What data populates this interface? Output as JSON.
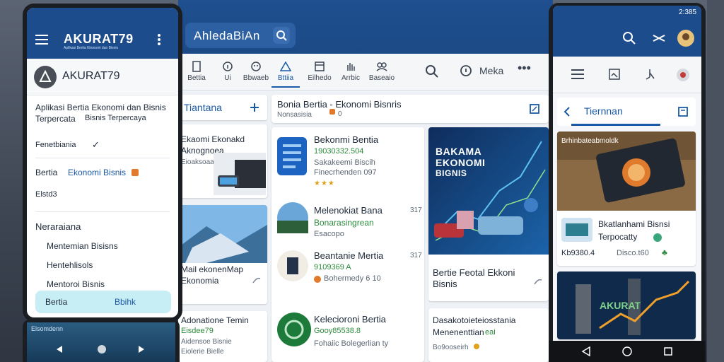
{
  "left_phone": {
    "status_time": "",
    "brand": "AKURAT79",
    "brand_tagline": "Aplikasi Berita Ekonomi dan Bisnis",
    "drawer_brand": "AKURAT79",
    "description_line1": "Aplikasi Bertia Ekonomi dan Bisnis",
    "description_line2": "Terpercata",
    "description_line2b": "Bisnis Terpercaya",
    "verified_label": "Fenetbiania",
    "menu_item_1": "Bertia",
    "menu_item_1b": "Ekonomi Bisnis",
    "menu_item_2": "Elstd3",
    "section_title": "Neraraiana",
    "sub_1": "Mentemian Bisisns",
    "sub_2": "Hentehlisols",
    "sub_3": "Mentoroi Bisnis",
    "active_left": "Bertia",
    "active_right": "Bbihk",
    "bottom_label": "Elsomdenn"
  },
  "tablet": {
    "search_text": "AhledaBiAn",
    "toolbar": [
      {
        "label": "Bettia",
        "icon": "bookmark-icon"
      },
      {
        "label": "Ui",
        "icon": "info-icon"
      },
      {
        "label": "Bbwaeb",
        "icon": "face-icon"
      },
      {
        "label": "Bttiia",
        "icon": "warning-icon"
      },
      {
        "label": "Eilhedo",
        "icon": "calendar-icon"
      },
      {
        "label": "Arrbic",
        "icon": "hand-icon"
      },
      {
        "label": "Baseaio",
        "icon": "people-icon"
      }
    ],
    "toolbar_right_label": "Meka",
    "left_column": {
      "title": "Tiantana",
      "items": [
        {
          "title": "Ekaomi Ekonakd",
          "subtitle": "Aknognoea",
          "meta": "Eioaksoaa"
        },
        {
          "title": "Mail ekonenMap",
          "subtitle": "Ekonomia"
        },
        {
          "title": "Adonatione Temin",
          "subtitle": "Eisdee79",
          "meta": "Aidensoe Bisnie",
          "meta2": "Eiolerie Bielle"
        }
      ]
    },
    "feed_header": {
      "title": "Bonia Bertia - Ekonomi Bisnris",
      "subtitle": "Nonsasisia",
      "count": "0"
    },
    "feed": [
      {
        "title": "Bekonmi Bentia",
        "line1": "19030332.504",
        "line2": "Sakakeemi Biscih",
        "line3": "Finecrhenden 097"
      },
      {
        "title": "Melenokiat Bana",
        "line1": "Bonarasingrean",
        "line2": "Esacopo",
        "meta": "317"
      },
      {
        "title": "Beantanie Mertia",
        "line1": "9109369 A",
        "line2": "Bohermedy 6 10",
        "meta": "317"
      },
      {
        "title": "Kelecioroni Bertia",
        "line1": "Gooy85538.8",
        "line2": "Fohaiic Bolegerlian ty"
      }
    ],
    "feature_top": {
      "image_text_1": "BAKAMA",
      "image_text_2": "EKONOMI",
      "image_text_3": "BIGNIS",
      "caption_line1": "Bertie Feotal Ekkoni",
      "caption_line2": "Bisnis"
    },
    "feature_bottom": {
      "line1": "Dasakotoieteiosstania",
      "line2": "Menenenttian",
      "line2b": "eai",
      "meta": "Bo9ooseirh"
    }
  },
  "right_phone": {
    "status_time": "2:385",
    "tab_title": "Tiernnan",
    "card1": {
      "image_text": "Brhinbateabmoldk",
      "title": "Bkatlanhami Bisnsi",
      "subtitle": "Terpocatty",
      "meta_left": "Kb9380.4",
      "meta_right": "Disco.t60"
    },
    "card2": {
      "image_text": "AKURAT"
    }
  },
  "colors": {
    "brand_blue": "#1d4c8d",
    "accent_blue": "#1b5aa6",
    "green": "#2e8b3d",
    "amber": "#e0a21b"
  }
}
